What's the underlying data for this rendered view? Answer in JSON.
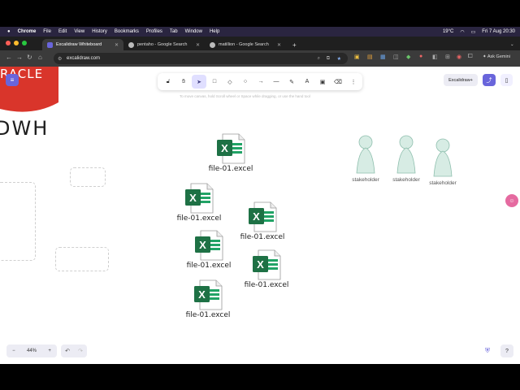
{
  "menubar": {
    "apple": "",
    "app": "Chrome",
    "items": [
      "File",
      "Edit",
      "View",
      "History",
      "Bookmarks",
      "Profiles",
      "Tab",
      "Window",
      "Help"
    ],
    "temp": "19°C",
    "datetime": "Fri 7 Aug  20:30"
  },
  "tabs": [
    {
      "label": "Excalidraw Whiteboard",
      "active": true
    },
    {
      "label": "pentaho - Google Search",
      "active": false
    },
    {
      "label": "matillion - Google Search",
      "active": false
    }
  ],
  "new_tab": "+",
  "address": {
    "url": "excalidraw.com",
    "ask": "Ask Gemini"
  },
  "toolbar": {
    "tools": [
      {
        "name": "lock-icon",
        "glyph": "🔓︎"
      },
      {
        "name": "hand-icon",
        "glyph": "✋︎"
      },
      {
        "name": "selection-icon",
        "glyph": "➤"
      },
      {
        "name": "rectangle-icon",
        "glyph": "□"
      },
      {
        "name": "diamond-icon",
        "glyph": "◇"
      },
      {
        "name": "ellipse-icon",
        "glyph": "○"
      },
      {
        "name": "arrow-icon",
        "glyph": "→"
      },
      {
        "name": "line-icon",
        "glyph": "—"
      },
      {
        "name": "pencil-icon",
        "glyph": "✎"
      },
      {
        "name": "text-icon",
        "glyph": "A"
      },
      {
        "name": "image-icon",
        "glyph": "▣"
      },
      {
        "name": "eraser-icon",
        "glyph": "⌫"
      },
      {
        "name": "more-tools-icon",
        "glyph": "⋮"
      }
    ]
  },
  "hint": "To move canvas, hold Scroll wheel or Space while dragging, or use the hand tool",
  "library_button": "Excalidraw+",
  "zoom": {
    "minus": "−",
    "value": "44%",
    "plus": "+"
  },
  "canvas_text": {
    "oracle": "RACLE",
    "dwh": "DWH"
  },
  "files": [
    {
      "label": "file-01.excel"
    },
    {
      "label": "file-01.excel"
    },
    {
      "label": "file-01.excel"
    },
    {
      "label": "file-01.excel"
    },
    {
      "label": "file-01.excel"
    },
    {
      "label": "file-01.excel"
    }
  ],
  "stakeholders": [
    {
      "label": "stakeholder"
    },
    {
      "label": "stakeholder"
    },
    {
      "label": "stakeholder"
    }
  ],
  "colors": {
    "accent": "#6965db",
    "excel": "#1e7145",
    "oracle": "#d9352b",
    "person": "#d7ece4"
  }
}
